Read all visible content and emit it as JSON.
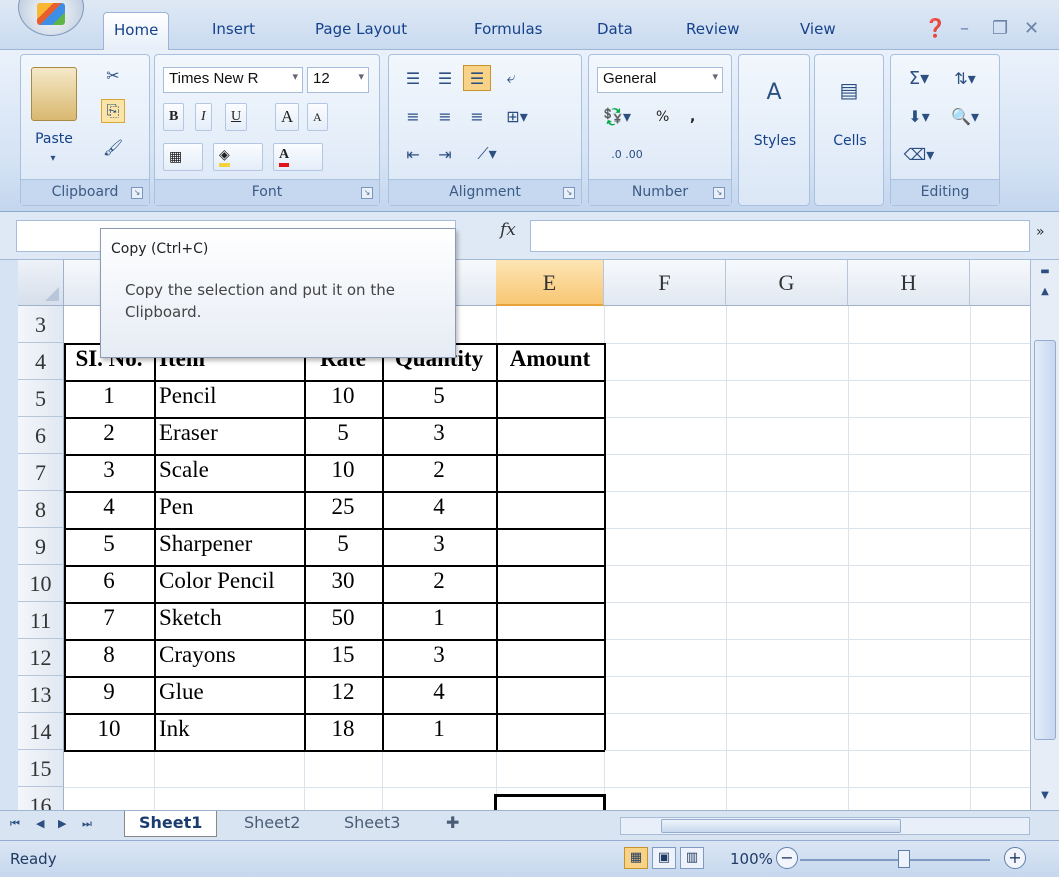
{
  "ribbon_tabs": [
    "Home",
    "Insert",
    "Page Layout",
    "Formulas",
    "Data",
    "Review",
    "View"
  ],
  "ribbon": {
    "clipboard": {
      "label": "Clipboard",
      "paste": "Paste"
    },
    "font": {
      "label": "Font",
      "font_name": "Times New R",
      "font_size": "12",
      "bold": "B",
      "italic": "I",
      "underline": "U",
      "grow": "A",
      "shrink": "A",
      "font_color": "A"
    },
    "alignment": {
      "label": "Alignment"
    },
    "number": {
      "label": "Number",
      "format": "General",
      "percent": "%",
      "comma": ",",
      "inc_dec": "←.0 .00",
      "dec_dec": ".00 →.0"
    },
    "styles": {
      "label": "Styles"
    },
    "cells": {
      "label": "Cells"
    },
    "editing": {
      "label": "Editing",
      "sum": "Σ"
    }
  },
  "formula_bar": {
    "fx": "fx",
    "value": ""
  },
  "tooltip": {
    "title": "Copy (Ctrl+C)",
    "body": "Copy the selection and put it on the Clipboard."
  },
  "columns": [
    "E",
    "F",
    "G",
    "H"
  ],
  "rows": [
    "3",
    "4",
    "5",
    "6",
    "7",
    "8",
    "9",
    "10",
    "11",
    "12",
    "13",
    "14",
    "15",
    "16"
  ],
  "table": {
    "headers": [
      "SI. No.",
      "Item",
      "Rate",
      "Quantity",
      "Amount"
    ],
    "rows": [
      [
        "1",
        "Pencil",
        "10",
        "5",
        ""
      ],
      [
        "2",
        "Eraser",
        "5",
        "3",
        ""
      ],
      [
        "3",
        "Scale",
        "10",
        "2",
        ""
      ],
      [
        "4",
        "Pen",
        "25",
        "4",
        ""
      ],
      [
        "5",
        "Sharpener",
        "5",
        "3",
        ""
      ],
      [
        "6",
        "Color Pencil",
        "30",
        "2",
        ""
      ],
      [
        "7",
        "Sketch",
        "50",
        "1",
        ""
      ],
      [
        "8",
        "Crayons",
        "15",
        "3",
        ""
      ],
      [
        "9",
        "Glue",
        "12",
        "4",
        ""
      ],
      [
        "10",
        "Ink",
        "18",
        "1",
        ""
      ]
    ]
  },
  "sheets": [
    "Sheet1",
    "Sheet2",
    "Sheet3"
  ],
  "active_sheet": "Sheet1",
  "status": {
    "ready": "Ready",
    "zoom": "100%"
  },
  "colors": {
    "accent": "#15428b",
    "selected_header": "#f8c774"
  }
}
